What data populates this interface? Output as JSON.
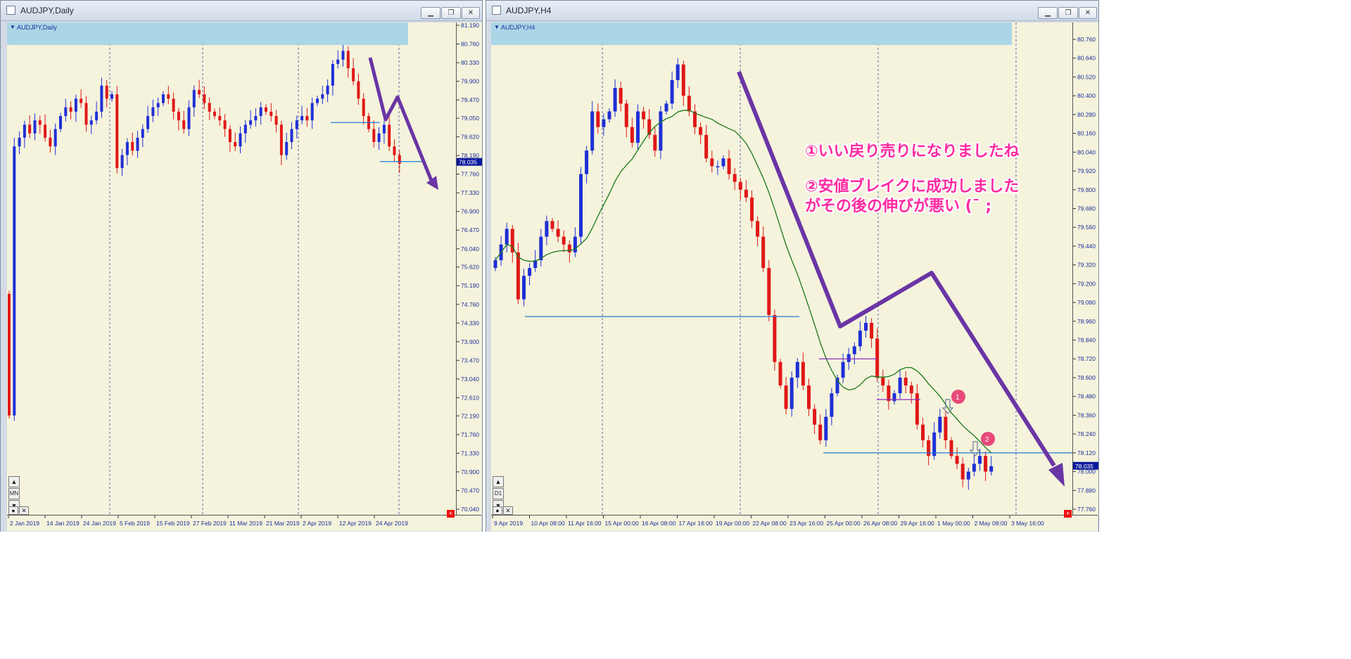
{
  "windows": [
    {
      "title": "AUDJPY,Daily",
      "symbol_label": "AUDJPY,Daily",
      "period_button": "MN",
      "price_tag": "78.035",
      "y_ticks": [
        "81.190",
        "80.760",
        "80.330",
        "79.900",
        "79.470",
        "79.050",
        "78.620",
        "78.190",
        "77.760",
        "77.330",
        "76.900",
        "76.470",
        "76.040",
        "75.620",
        "75.190",
        "74.760",
        "74.330",
        "73.900",
        "73.470",
        "73.040",
        "72.610",
        "72.190",
        "71.760",
        "71.330",
        "70.900",
        "70.470",
        "70.040"
      ],
      "x_labels": [
        "2 Jan 2019",
        "14 Jan 2019",
        "24 Jan 2019",
        "5 Feb 2019",
        "15 Feb 2019",
        "27 Feb 2019",
        "11 Mar 2019",
        "21 Mar 2019",
        "2 Apr 2019",
        "12 Apr 2019",
        "24 Apr 2019"
      ]
    },
    {
      "title": "AUDJPY,H4",
      "symbol_label": "AUDJPY,H4",
      "period_button": "D1",
      "price_tag": "78.035",
      "y_ticks": [
        "80.760",
        "80.640",
        "80.520",
        "80.400",
        "80.280",
        "80.160",
        "80.040",
        "79.920",
        "79.800",
        "79.680",
        "79.560",
        "79.440",
        "79.320",
        "79.200",
        "79.080",
        "78.960",
        "78.840",
        "78.720",
        "78.600",
        "78.480",
        "78.360",
        "78.240",
        "78.120",
        "78.000",
        "77.880",
        "77.760"
      ],
      "x_labels": [
        "9 Apr 2019",
        "10 Apr 08:00",
        "11 Apr 16:00",
        "15 Apr 00:00",
        "16 Apr 08:00",
        "17 Apr 16:00",
        "19 Apr 00:00",
        "22 Apr 08:00",
        "23 Apr 16:00",
        "25 Apr 00:00",
        "26 Apr 08:00",
        "29 Apr 16:00",
        "1 May 00:00",
        "2 May 08:00",
        "3 May 16:00"
      ],
      "annotations": {
        "line1": "①いい戻り売りになりましたね",
        "line2": "②安値ブレイクに成功しました",
        "line3": "がその後の伸びが悪い (¯ ;",
        "marker1": "1",
        "marker2": "2"
      }
    }
  ],
  "colors": {
    "background": "#f5f3dc",
    "bull": "#1f2fd6",
    "bear": "#e01818",
    "ma": "#1a7a1a",
    "arrow": "#6a35a5",
    "level": "#1e7bd6",
    "note": "#ff2aa0",
    "symbol_band": "#abd6e6"
  },
  "chart_data": [
    {
      "type": "candlestick",
      "symbol": "AUDJPY",
      "timeframe": "Daily",
      "ylim": [
        70.04,
        81.19
      ],
      "last_price": 78.035,
      "closes": [
        72.2,
        78.4,
        78.6,
        78.9,
        78.7,
        79.0,
        78.9,
        78.6,
        78.4,
        78.8,
        79.1,
        79.3,
        79.2,
        79.5,
        79.4,
        78.9,
        79.0,
        79.2,
        79.8,
        79.5,
        79.6,
        77.9,
        78.2,
        78.5,
        78.3,
        78.6,
        78.8,
        79.1,
        79.3,
        79.4,
        79.6,
        79.5,
        79.2,
        79.0,
        78.8,
        79.3,
        79.7,
        79.6,
        79.4,
        79.2,
        79.1,
        79.0,
        78.8,
        78.5,
        78.4,
        78.7,
        78.9,
        79.0,
        79.1,
        79.3,
        79.2,
        79.1,
        78.9,
        78.2,
        78.5,
        78.8,
        79.0,
        79.1,
        79.0,
        79.4,
        79.5,
        79.6,
        79.8,
        80.3,
        80.4,
        80.6,
        80.2,
        79.9,
        79.5,
        79.1,
        78.8,
        78.5,
        78.7,
        78.9,
        78.4,
        78.2,
        78.0
      ]
    },
    {
      "type": "candlestick",
      "symbol": "AUDJPY",
      "timeframe": "H4",
      "ylim": [
        77.76,
        80.76
      ],
      "last_price": 78.035,
      "indicator": "moving average",
      "closes": [
        79.35,
        79.45,
        79.55,
        79.4,
        79.1,
        79.25,
        79.3,
        79.35,
        79.5,
        79.6,
        79.55,
        79.5,
        79.45,
        79.4,
        79.5,
        79.9,
        80.05,
        80.3,
        80.2,
        80.25,
        80.3,
        80.45,
        80.35,
        80.2,
        80.1,
        80.3,
        80.25,
        80.15,
        80.05,
        80.3,
        80.35,
        80.5,
        80.6,
        80.4,
        80.3,
        80.2,
        80.15,
        80.0,
        79.95,
        79.95,
        80.0,
        79.9,
        79.85,
        79.8,
        79.75,
        79.6,
        79.5,
        79.3,
        79.0,
        78.7,
        78.55,
        78.4,
        78.6,
        78.7,
        78.55,
        78.4,
        78.3,
        78.2,
        78.35,
        78.5,
        78.6,
        78.7,
        78.75,
        78.8,
        78.9,
        78.95,
        78.85,
        78.6,
        78.55,
        78.45,
        78.5,
        78.6,
        78.55,
        78.5,
        78.3,
        78.2,
        78.1,
        78.25,
        78.35,
        78.2,
        78.1,
        78.05,
        77.95,
        78.0,
        78.05,
        78.1,
        78.0,
        78.035
      ]
    }
  ]
}
